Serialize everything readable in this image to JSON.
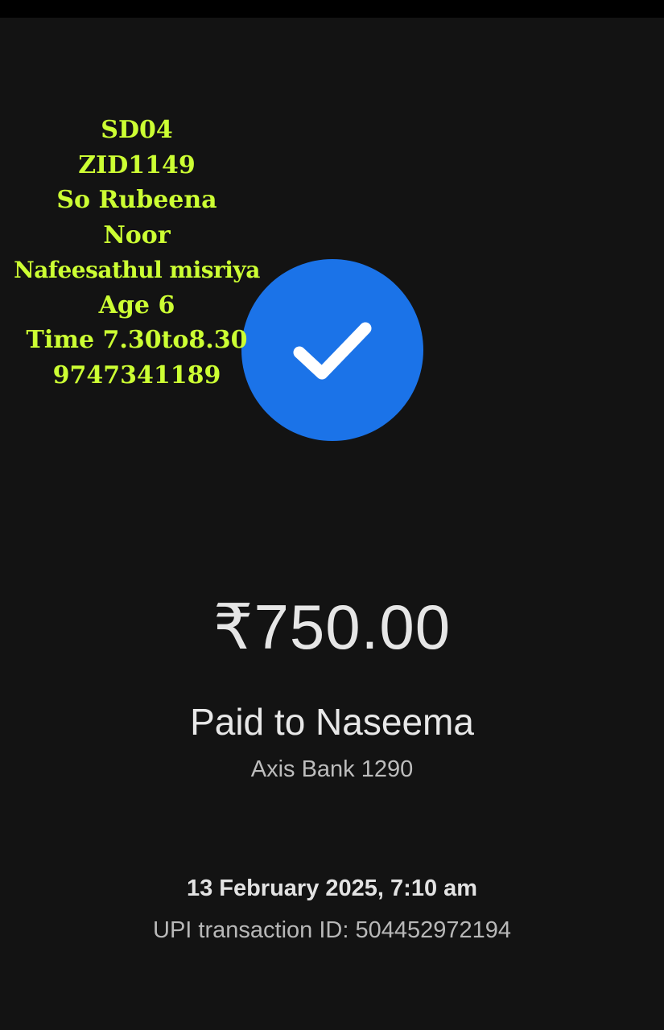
{
  "overlay_note": {
    "lines": [
      "SD04",
      "ZID1149",
      "So Rubeena",
      "Noor",
      "Nafeesathul misriya",
      "Age 6",
      "Time 7.30to8.30",
      "9747341189"
    ],
    "color": "#ccff33"
  },
  "status": {
    "icon": "checkmark-icon",
    "circle_color": "#1b73e8"
  },
  "payment": {
    "amount": "₹750.00",
    "paid_to": "Paid to Naseema",
    "bank": "Axis Bank 1290",
    "datetime": "13 February 2025, 7:10 am",
    "transaction_id": "UPI transaction ID: 504452972194"
  },
  "theme": {
    "background": "#131313"
  }
}
